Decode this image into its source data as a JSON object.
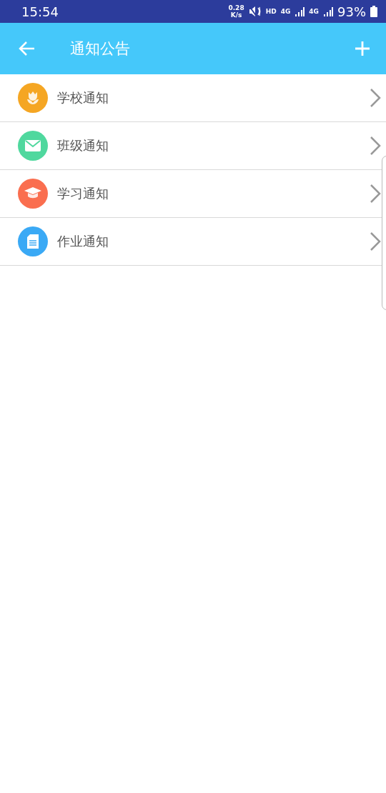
{
  "status_bar": {
    "time": "15:54",
    "speed_value": "0.28",
    "speed_unit": "K/s",
    "hd": "HD",
    "network_1": "4G",
    "network_2": "4G",
    "battery": "93%"
  },
  "header": {
    "title": "通知公告"
  },
  "items": [
    {
      "kind": "school",
      "label": "学校通知",
      "color": "#f5a623"
    },
    {
      "kind": "class",
      "label": "班级通知",
      "color": "#4fd89e"
    },
    {
      "kind": "study",
      "label": "学习通知",
      "color": "#fa6e4f"
    },
    {
      "kind": "homework",
      "label": "作业通知",
      "color": "#3aa9f5"
    }
  ]
}
